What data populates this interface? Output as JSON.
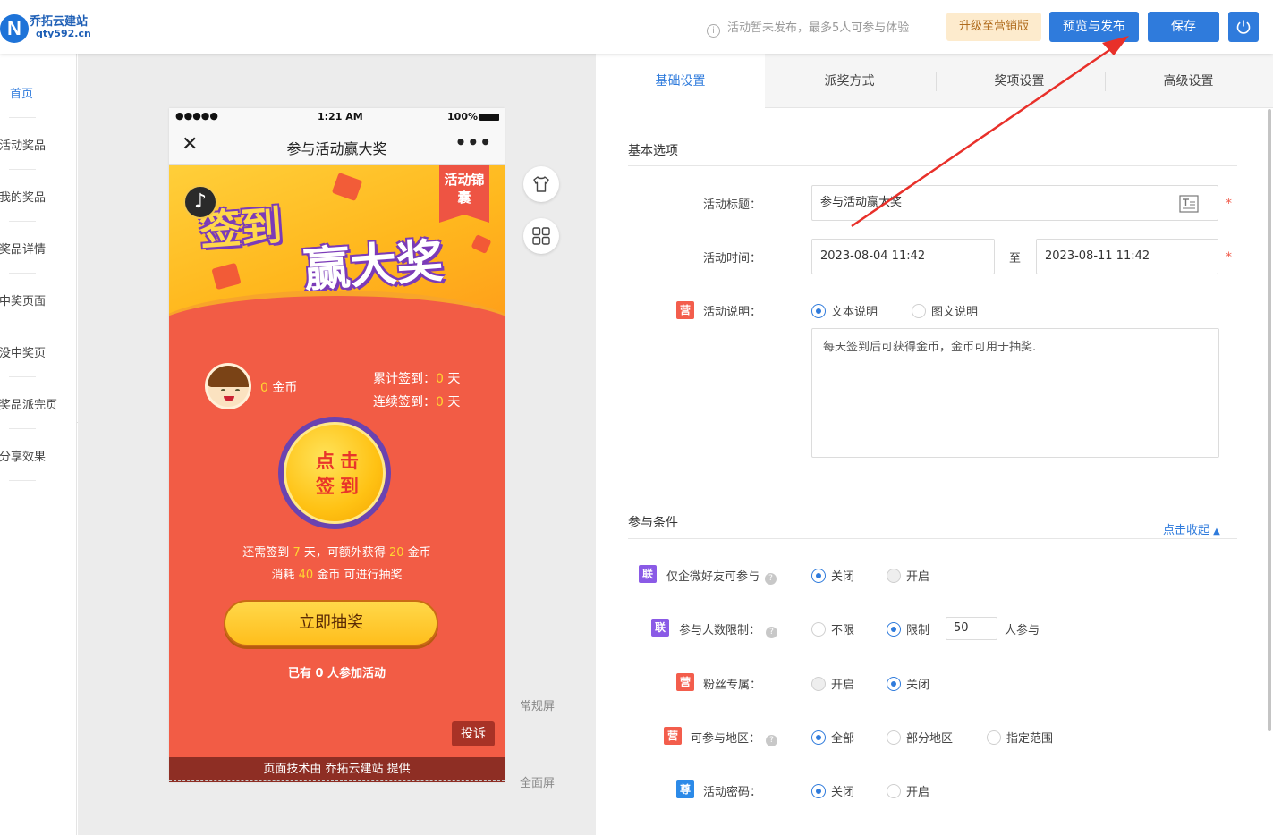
{
  "header": {
    "logo_mark": "N",
    "logo_name": "乔拓云建站",
    "logo_url": "qty592.cn",
    "notice": "活动暂未发布，最多5人可参与体验",
    "upgrade_label": "升级至营销版",
    "preview_label": "预览与发布",
    "save_label": "保存"
  },
  "sidebar": {
    "items": [
      {
        "label": "首页"
      },
      {
        "label": "活动奖品"
      },
      {
        "label": "我的奖品"
      },
      {
        "label": "奖品详情"
      },
      {
        "label": "中奖页面"
      },
      {
        "label": "没中奖页"
      },
      {
        "label": "奖品派完页"
      },
      {
        "label": "分享效果"
      }
    ],
    "collapse_glyph": "«"
  },
  "phone": {
    "status_dots": "●●●●●",
    "time": "1:21 AM",
    "battery": "100%",
    "title": "参与活动赢大奖",
    "close_glyph": "✕",
    "more_glyph": "•••",
    "ribbon": "活动锦囊",
    "banner_line1": "签到",
    "banner_line2": "赢大奖",
    "coins": "0",
    "coins_unit": "金币",
    "total_sign_label": "累计签到：",
    "total_sign_value": "0",
    "continuous_sign_label": "连续签到：",
    "continuous_sign_value": "0",
    "day_unit": "天",
    "sign_button_line1": "点击",
    "sign_button_line2": "签到",
    "tip1_a": "还需签到",
    "tip1_days": "7",
    "tip1_b": "天，可额外获得",
    "tip1_coins": "20",
    "tip1_c": "金币",
    "tip2_a": "消耗",
    "tip2_coins": "40",
    "tip2_b": "金币 可进行抽奖",
    "draw_label": "立即抽奖",
    "joined_text": "已有 0 人参加活动",
    "complain_label": "投诉",
    "footer": "页面技术由 乔拓云建站 提供"
  },
  "canvas": {
    "normal_screen_label": "常规屏",
    "full_screen_label": "全面屏"
  },
  "tabs": [
    {
      "label": "基础设置"
    },
    {
      "label": "派奖方式"
    },
    {
      "label": "奖项设置"
    },
    {
      "label": "高级设置"
    }
  ],
  "basic": {
    "section_title": "基本选项",
    "title_label": "活动标题：",
    "title_value": "参与活动赢大奖",
    "time_label": "活动时间：",
    "start_time": "2023-08-04 11:42",
    "to_label": "至",
    "end_time": "2023-08-11 11:42",
    "desc_label": "活动说明：",
    "desc_option_text": "文本说明",
    "desc_option_rich": "图文说明",
    "desc_value": "每天签到后可获得金币，金币可用于抽奖."
  },
  "conditions": {
    "section_title": "参与条件",
    "collapse_label": "点击收起",
    "wechat_friends_label": "仅企微好友可参与",
    "participant_limit_label": "参与人数限制：",
    "fans_only_label": "粉丝专属：",
    "region_label": "可参与地区：",
    "password_label": "活动密码：",
    "off": "关闭",
    "on": "开启",
    "unlimited": "不限",
    "limited": "限制",
    "limit_value": "50",
    "limit_suffix": "人参与",
    "region_all": "全部",
    "region_partial": "部分地区",
    "region_range": "指定范围"
  },
  "badges": {
    "marketing": "营",
    "union": "联",
    "premium": "尊"
  },
  "colors": {
    "accent": "#2f7bdc",
    "phone_background": "#f25c45",
    "badge_marketing": "#f35d4c",
    "badge_union": "#8a5ae6",
    "badge_premium": "#2c8ae8"
  }
}
